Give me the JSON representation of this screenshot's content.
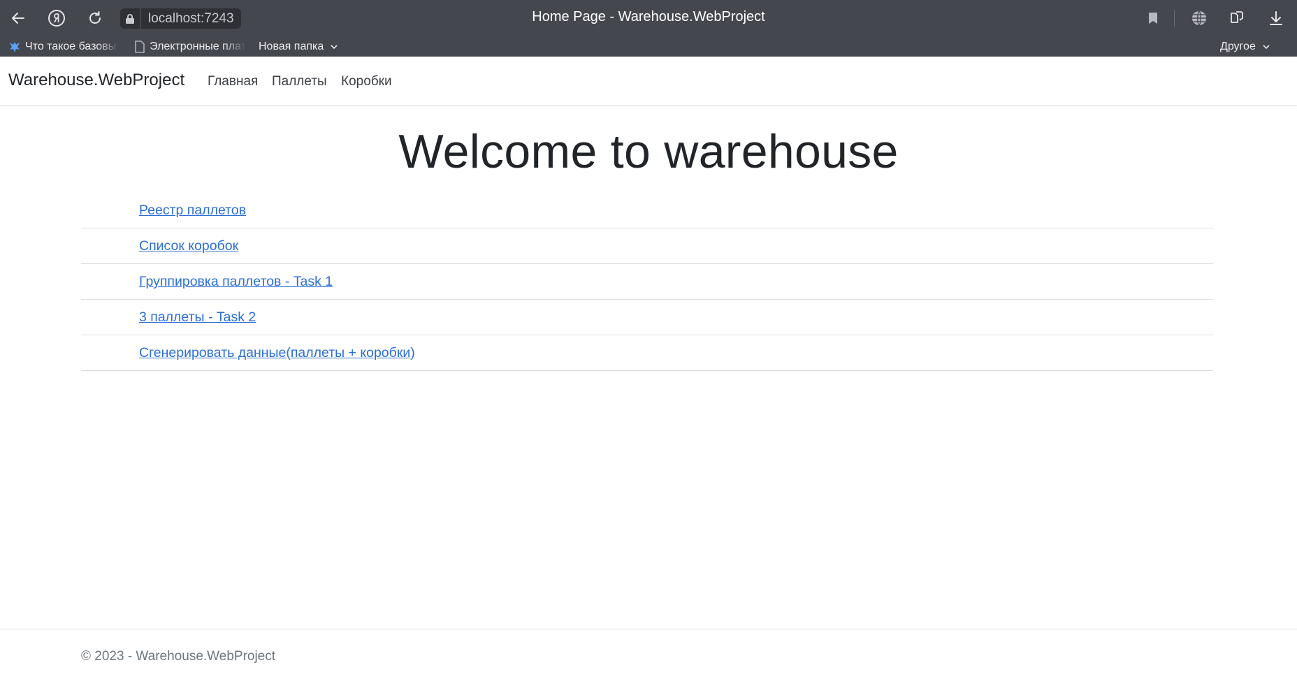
{
  "browser": {
    "url": "localhost:7243",
    "tab_title": "Home Page - Warehouse.WebProject",
    "icons": [
      "back-arrow-icon",
      "yandex-icon",
      "reload-icon",
      "lock-icon",
      "bookmark-icon",
      "globe-icon",
      "extensions-icon",
      "download-icon"
    ],
    "bookmarks": [
      {
        "label": "Что такое базовы",
        "icon": "dragon-icon"
      },
      {
        "label": "Электронные плат",
        "icon": "page-icon"
      },
      {
        "label": "Новая папка",
        "icon": "chevron-down-icon"
      }
    ],
    "other_bookmarks": "Другое"
  },
  "site": {
    "brand": "Warehouse.WebProject",
    "nav": [
      "Главная",
      "Паллеты",
      "Коробки"
    ],
    "heading": "Welcome to warehouse",
    "links": [
      "Реестр паллетов",
      "Список коробок",
      "Группировка паллетов - Task 1",
      "3 паллеты - Task 2",
      "Сгенерировать данные(паллеты + коробки)"
    ],
    "footer": "© 2023 - Warehouse.WebProject"
  },
  "colors": {
    "chrome_bg": "#45474f",
    "link": "#2b6fd6",
    "footer_text": "#6c757d"
  }
}
